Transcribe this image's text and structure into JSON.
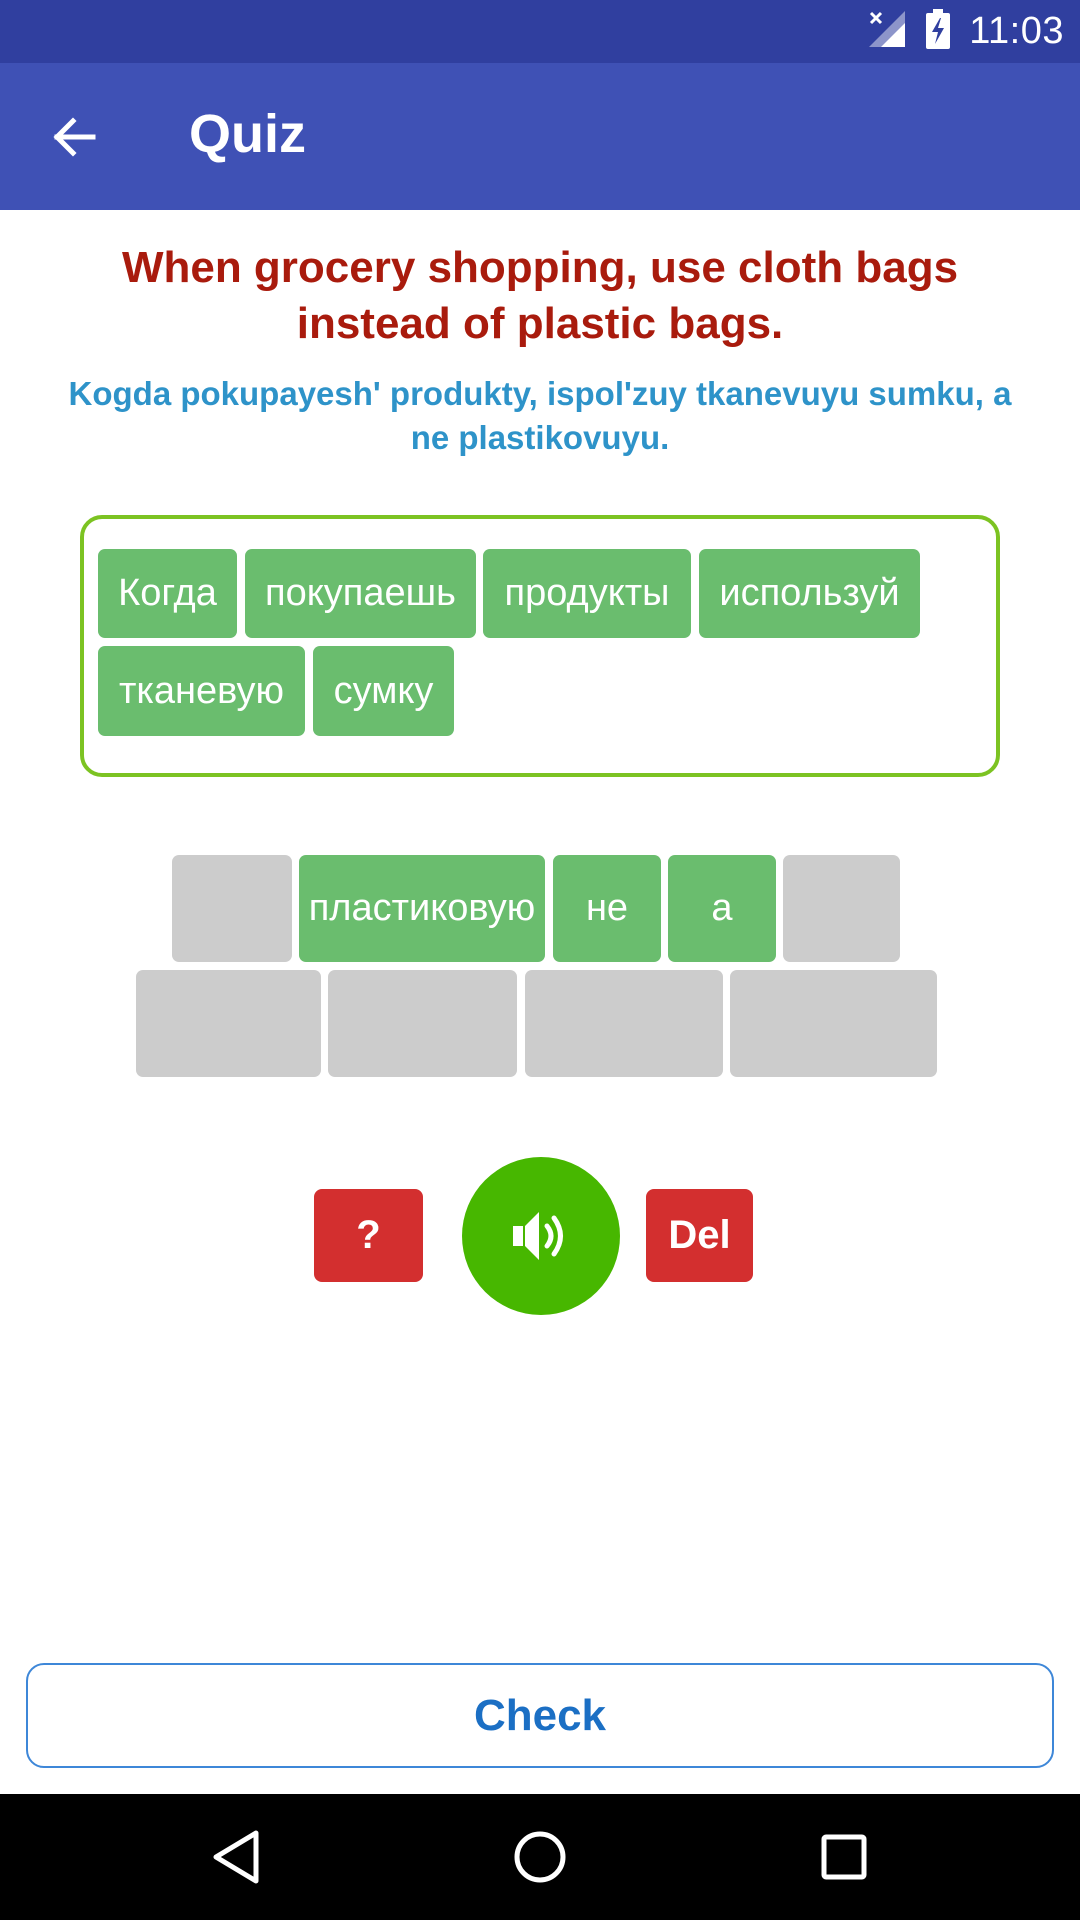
{
  "status_bar": {
    "time": "11:03"
  },
  "app_bar": {
    "title": "Quiz"
  },
  "question": {
    "english": "When grocery shopping, use cloth bags instead of plastic bags.",
    "transliteration": "Kogda pokupayesh' produkty, ispol'zuy tkanevuyu sumku, a ne plastikovuyu."
  },
  "answer_words": [
    "Когда",
    "покупаешь",
    "продукты",
    "используй",
    "тканевую",
    "сумку"
  ],
  "word_bank": {
    "row1": [
      "",
      "пластиковую",
      "не",
      "а",
      ""
    ],
    "row2": [
      "",
      "",
      "",
      ""
    ]
  },
  "controls": {
    "hint_label": "?",
    "delete_label": "Del"
  },
  "check_label": "Check",
  "colors": {
    "status_bar": "#303f9f",
    "app_bar": "#3f51b5",
    "question_en": "#a91b0d",
    "question_tr": "#2e93c9",
    "chip": "#6abd6e",
    "slot": "#cccccc",
    "answer_border": "#7cc322",
    "red_button": "#d32f2f",
    "speaker_button": "#47b700",
    "check_text": "#1b6fc4"
  }
}
